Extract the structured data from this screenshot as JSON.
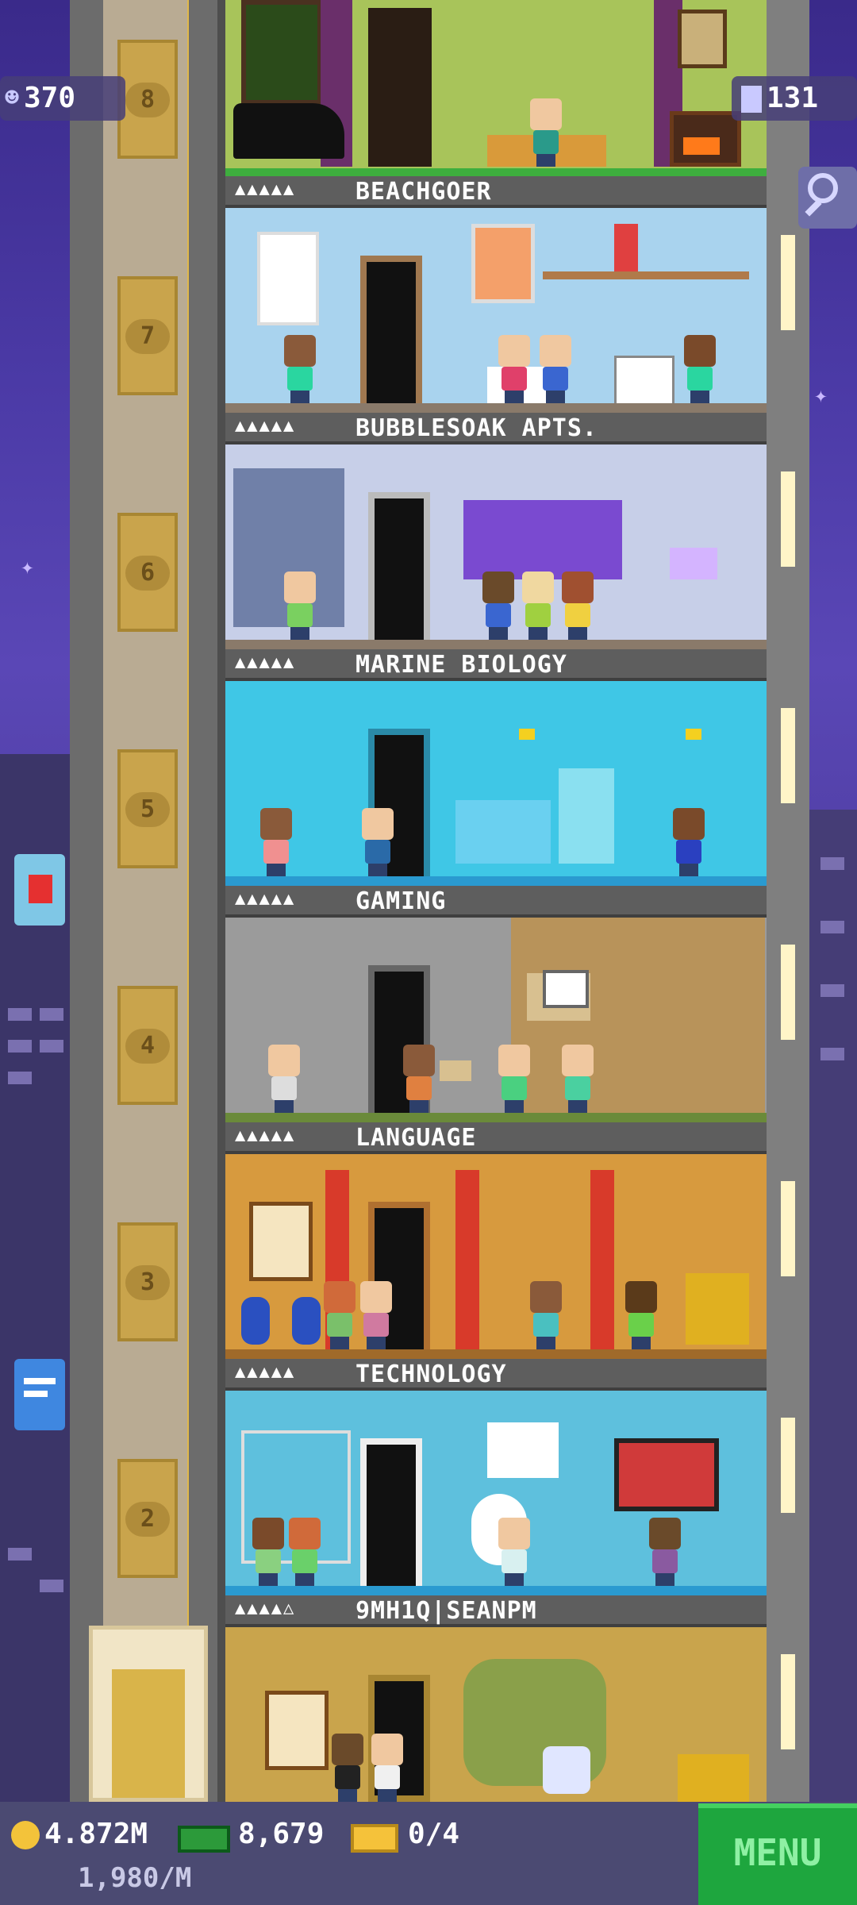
{
  "hud": {
    "population": "370",
    "floors_count": "131",
    "coins": "4.872M",
    "coin_rate": "1,980/M",
    "tower_bux": "8,679",
    "tickets": "0/4",
    "menu_label": "MENU"
  },
  "elevator": {
    "floor_numbers": [
      "8",
      "7",
      "6",
      "5",
      "4",
      "3",
      "2"
    ]
  },
  "floors": [
    {
      "name": "BEACHGOER",
      "rating": "▲▲▲▲▲"
    },
    {
      "name": "BUBBLESOAK APTS.",
      "rating": "▲▲▲▲▲"
    },
    {
      "name": "MARINE BIOLOGY",
      "rating": "▲▲▲▲▲"
    },
    {
      "name": "GAMING",
      "rating": "▲▲▲▲▲"
    },
    {
      "name": "LANGUAGE",
      "rating": "▲▲▲▲▲"
    },
    {
      "name": "TECHNOLOGY",
      "rating": "▲▲▲▲▲"
    },
    {
      "name": "9MH1Q|SEANPM",
      "rating": "▲▲▲▲△"
    }
  ],
  "colors": {
    "beachgoer_bg": "#a9d3ee",
    "bubblesoak_bg": "#c7cfe8",
    "marine_bg": "#3fc7e6",
    "gaming_bg": "#9b9b9b",
    "language_bg": "#d79a3e",
    "technology_bg": "#5ec0dd",
    "lobby_bg": "#c9a44c",
    "menu_green": "#1ea63e"
  },
  "icons": {
    "population": "person-icon",
    "floors": "building-grid-icon",
    "search": "magnifier-icon",
    "coin": "coin-icon",
    "bux": "tower-bux-icon",
    "ticket": "vip-ticket-icon"
  }
}
